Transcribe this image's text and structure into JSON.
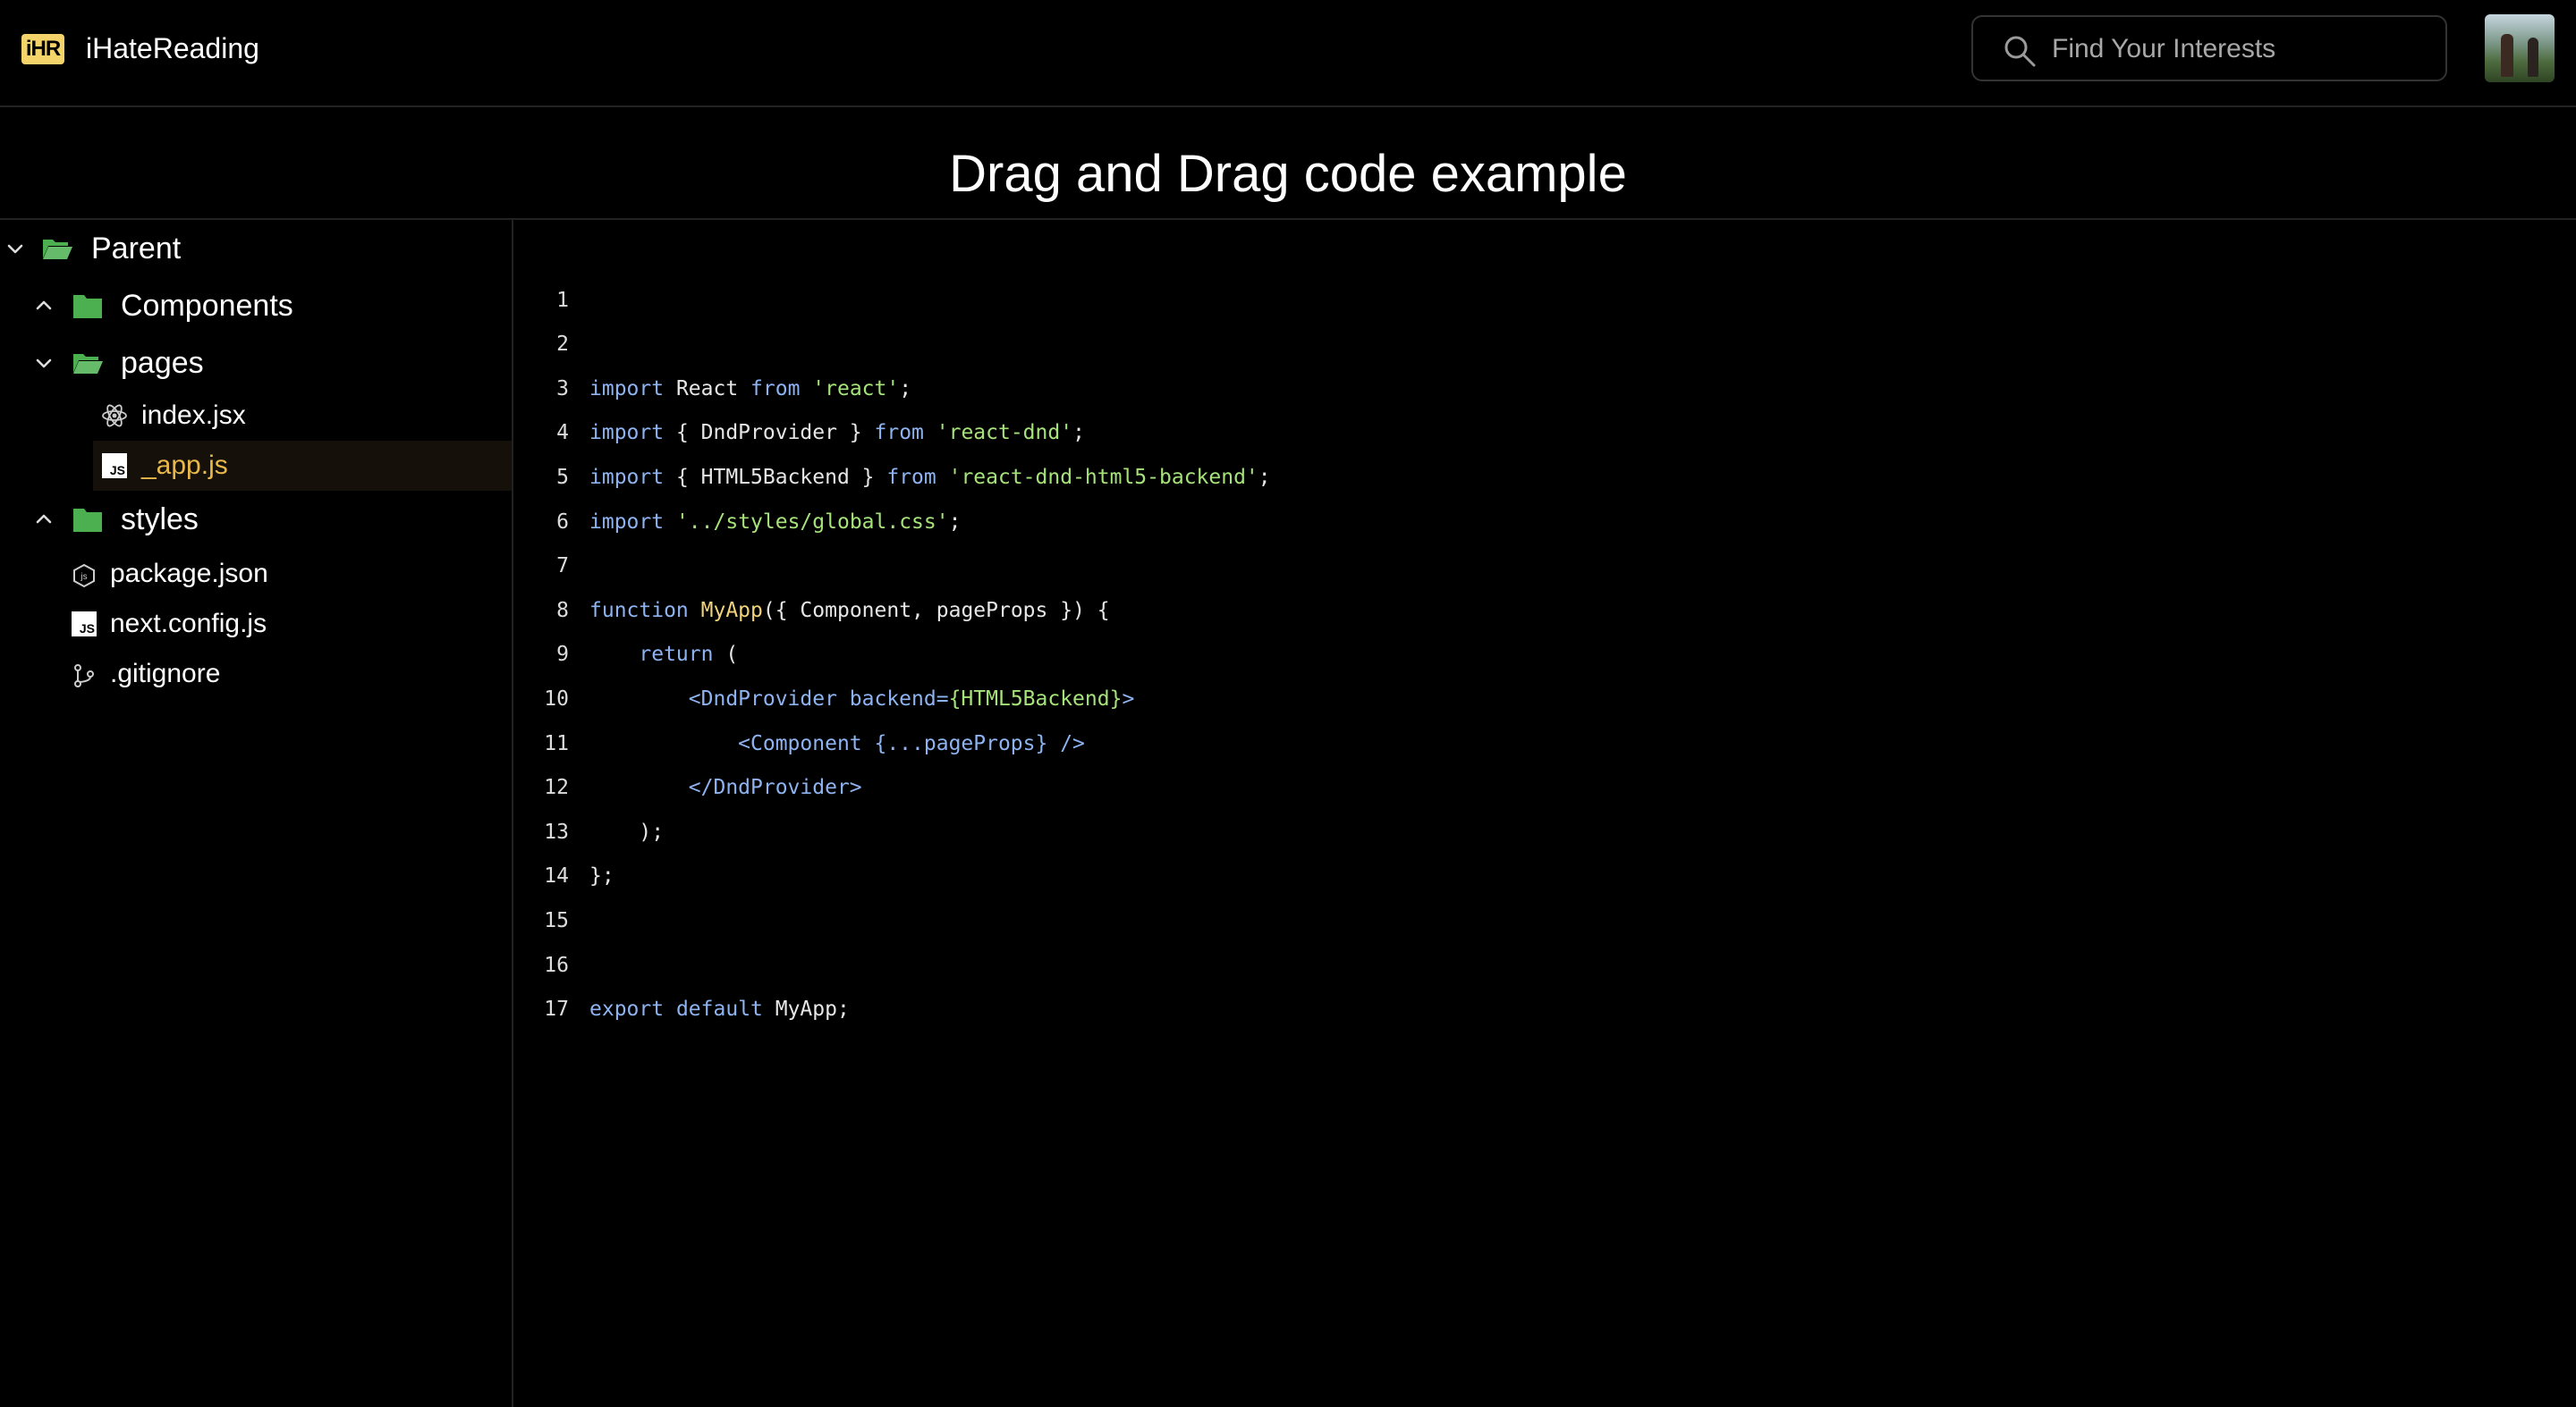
{
  "header": {
    "logo_text": "iHR",
    "app_title": "iHateReading",
    "search_placeholder": "Find Your Interests"
  },
  "page": {
    "title": "Drag and Drag code example"
  },
  "tree": {
    "parent": "Parent",
    "components": "Components",
    "pages": "pages",
    "index": "index.jsx",
    "app": "_app.js",
    "styles": "styles",
    "package": "package.json",
    "nextconfig": "next.config.js",
    "gitignore": ".gitignore",
    "js_badge": "JS"
  },
  "code": {
    "line_numbers": [
      "1",
      "2",
      "3",
      "4",
      "5",
      "6",
      "7",
      "8",
      "9",
      "10",
      "11",
      "12",
      "13",
      "14",
      "15",
      "16",
      "17"
    ],
    "t": {
      "import": "import",
      "from": "from",
      "react_ident": " React ",
      "react_str": "'react'",
      "semi": ";",
      "dnd_import": " { DndProvider } ",
      "react_dnd_str": "'react-dnd'",
      "html5_import": " { HTML5Backend } ",
      "html5_str": "'react-dnd-html5-backend'",
      "css_str": "'../styles/global.css'",
      "space": " ",
      "function": "function",
      "myapp_fn": "MyApp",
      "fn_args": "({ Component, pageProps }) {",
      "indent1": "    ",
      "return": "return",
      "open_paren": " (",
      "indent2": "        ",
      "dnd_open_tag": "<DndProvider backend=",
      "dnd_open_expr": "{HTML5Backend}",
      "gt": ">",
      "indent3": "            ",
      "component_tag": "<Component {...pageProps} />",
      "dnd_close_tag": "</DndProvider>",
      "close_paren": ");",
      "close_brace": "};",
      "export": "export",
      "default": "default",
      "export_rest": " MyApp;"
    }
  },
  "colors": {
    "keyword": "#8eb3f0",
    "string": "#a6e27a",
    "function_name": "#f0d37a",
    "folder": "#4caf50",
    "selected_text": "#e8b94a",
    "logo_bg": "#f5d36b"
  },
  "icons": {
    "search": "search-icon",
    "folder_open": "folder-open-icon",
    "folder": "folder-icon",
    "react": "react-icon",
    "js": "js-file-icon",
    "node": "nodejs-icon",
    "git": "git-branch-icon"
  }
}
